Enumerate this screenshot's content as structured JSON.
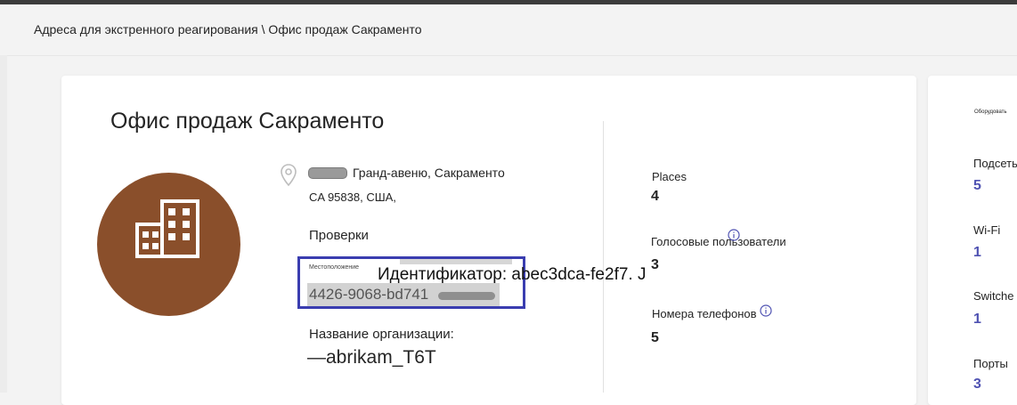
{
  "breadcrumb": "Адреса для экстренного реагирования \\ Офис продаж Сакраменто",
  "location": {
    "title": "Офис продаж Сакраменто",
    "address_line1": "Гранд-авеню, Сакраменто",
    "address_line2": "CA 95838, США,",
    "checks_label": "Проверки",
    "location_label": "Местоположение",
    "location_id_line1": "Идентификатор: abec3dca-fe2f7. J",
    "location_id_line2": "4426-9068-bd741",
    "org_label": "Название организации:",
    "org_value": "—abrikam_T6T"
  },
  "stats": {
    "places_label": "Places",
    "places_value": "4",
    "voice_users_label": "Голосовые пользователи",
    "voice_users_value": "3",
    "phone_numbers_label": "Номера телефонов",
    "phone_numbers_value": "5"
  },
  "side": {
    "header": "Оборудовать",
    "subnets_label": "Подсеть",
    "subnets_value": "5",
    "wifi_label": "Wi-Fi",
    "wifi_value": "1",
    "switches_label": "Switche",
    "switches_value": "1",
    "ports_label": "Порты",
    "ports_value": "3"
  },
  "colors": {
    "avatar_bg": "#8a4f2b",
    "highlight_border": "#3a3db0",
    "link_value": "#4f52b2"
  },
  "icons": [
    "location-pin-icon",
    "building-icon",
    "info-icon"
  ]
}
